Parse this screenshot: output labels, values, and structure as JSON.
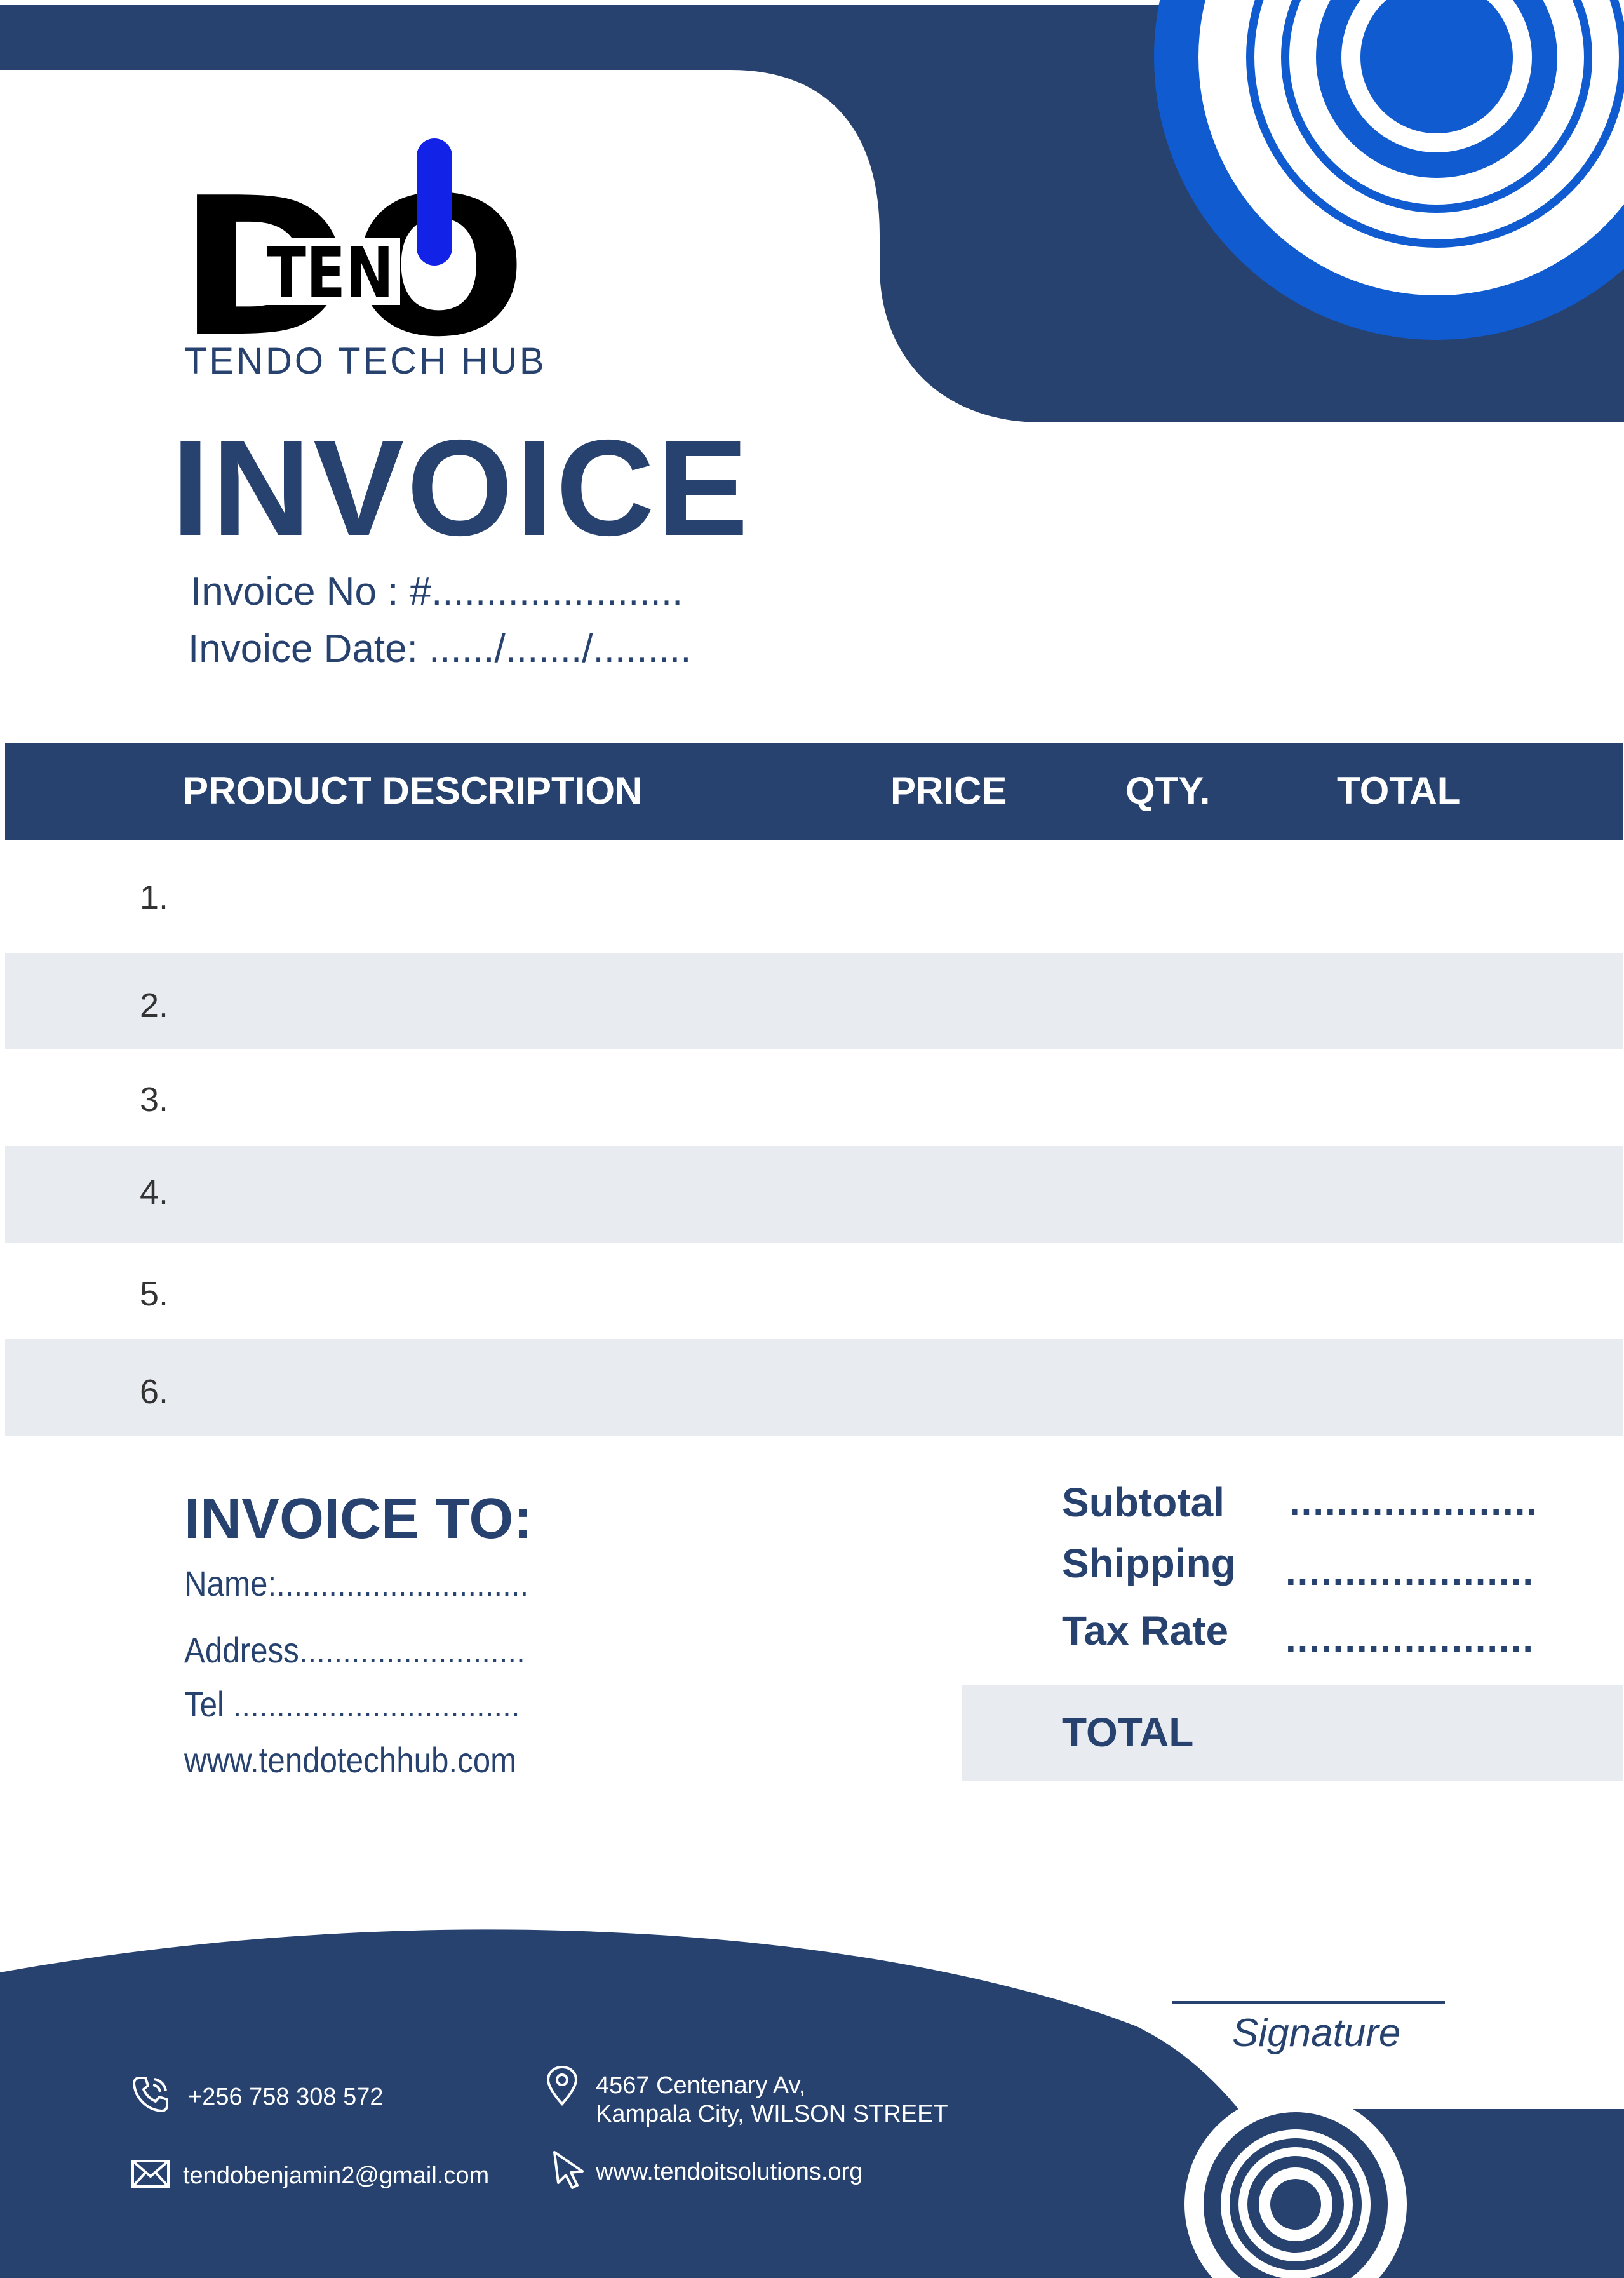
{
  "colors": {
    "navy": "#27426f",
    "blue": "#0f5bcf",
    "shade": "#e8ebf0",
    "logo_accent": "#1222e6"
  },
  "logo": {
    "text_main": "DO",
    "text_small": "TEN",
    "subtitle": "TENDO  TECH  HUB"
  },
  "title": "INVOICE",
  "meta": {
    "number": "Invoice No   : #.......................",
    "date": "Invoice Date: ....../......./........."
  },
  "table": {
    "headers": {
      "description": "PRODUCT DESCRIPTION",
      "price": "PRICE",
      "qty": "QTY.",
      "total": "TOTAL"
    },
    "rows": [
      "1.",
      "2.",
      "3.",
      "4.",
      "5.",
      "6."
    ]
  },
  "bill_to": {
    "title": "INVOICE TO:",
    "name": "Name:.............................",
    "address": "Address..........................",
    "tel": "Tel .................................",
    "website": "www.tendotechhub.com"
  },
  "summary": {
    "subtotal_label": "Subtotal",
    "subtotal_value": ".....................",
    "shipping_label": "Shipping",
    "shipping_value": ".....................",
    "tax_label": "Tax Rate",
    "tax_value": ".....................",
    "total_label": "TOTAL"
  },
  "signature": "Signature",
  "footer": {
    "phone": "+256 758 308 572",
    "email": "tendobenjamin2@gmail.com",
    "address_line1": "4567 Centenary Av,",
    "address_line2": "Kampala City, WILSON STREET",
    "website": "www.tendoitsolutions.org",
    "icons": [
      "phone-icon",
      "envelope-icon",
      "location-pin-icon",
      "cursor-icon"
    ]
  }
}
